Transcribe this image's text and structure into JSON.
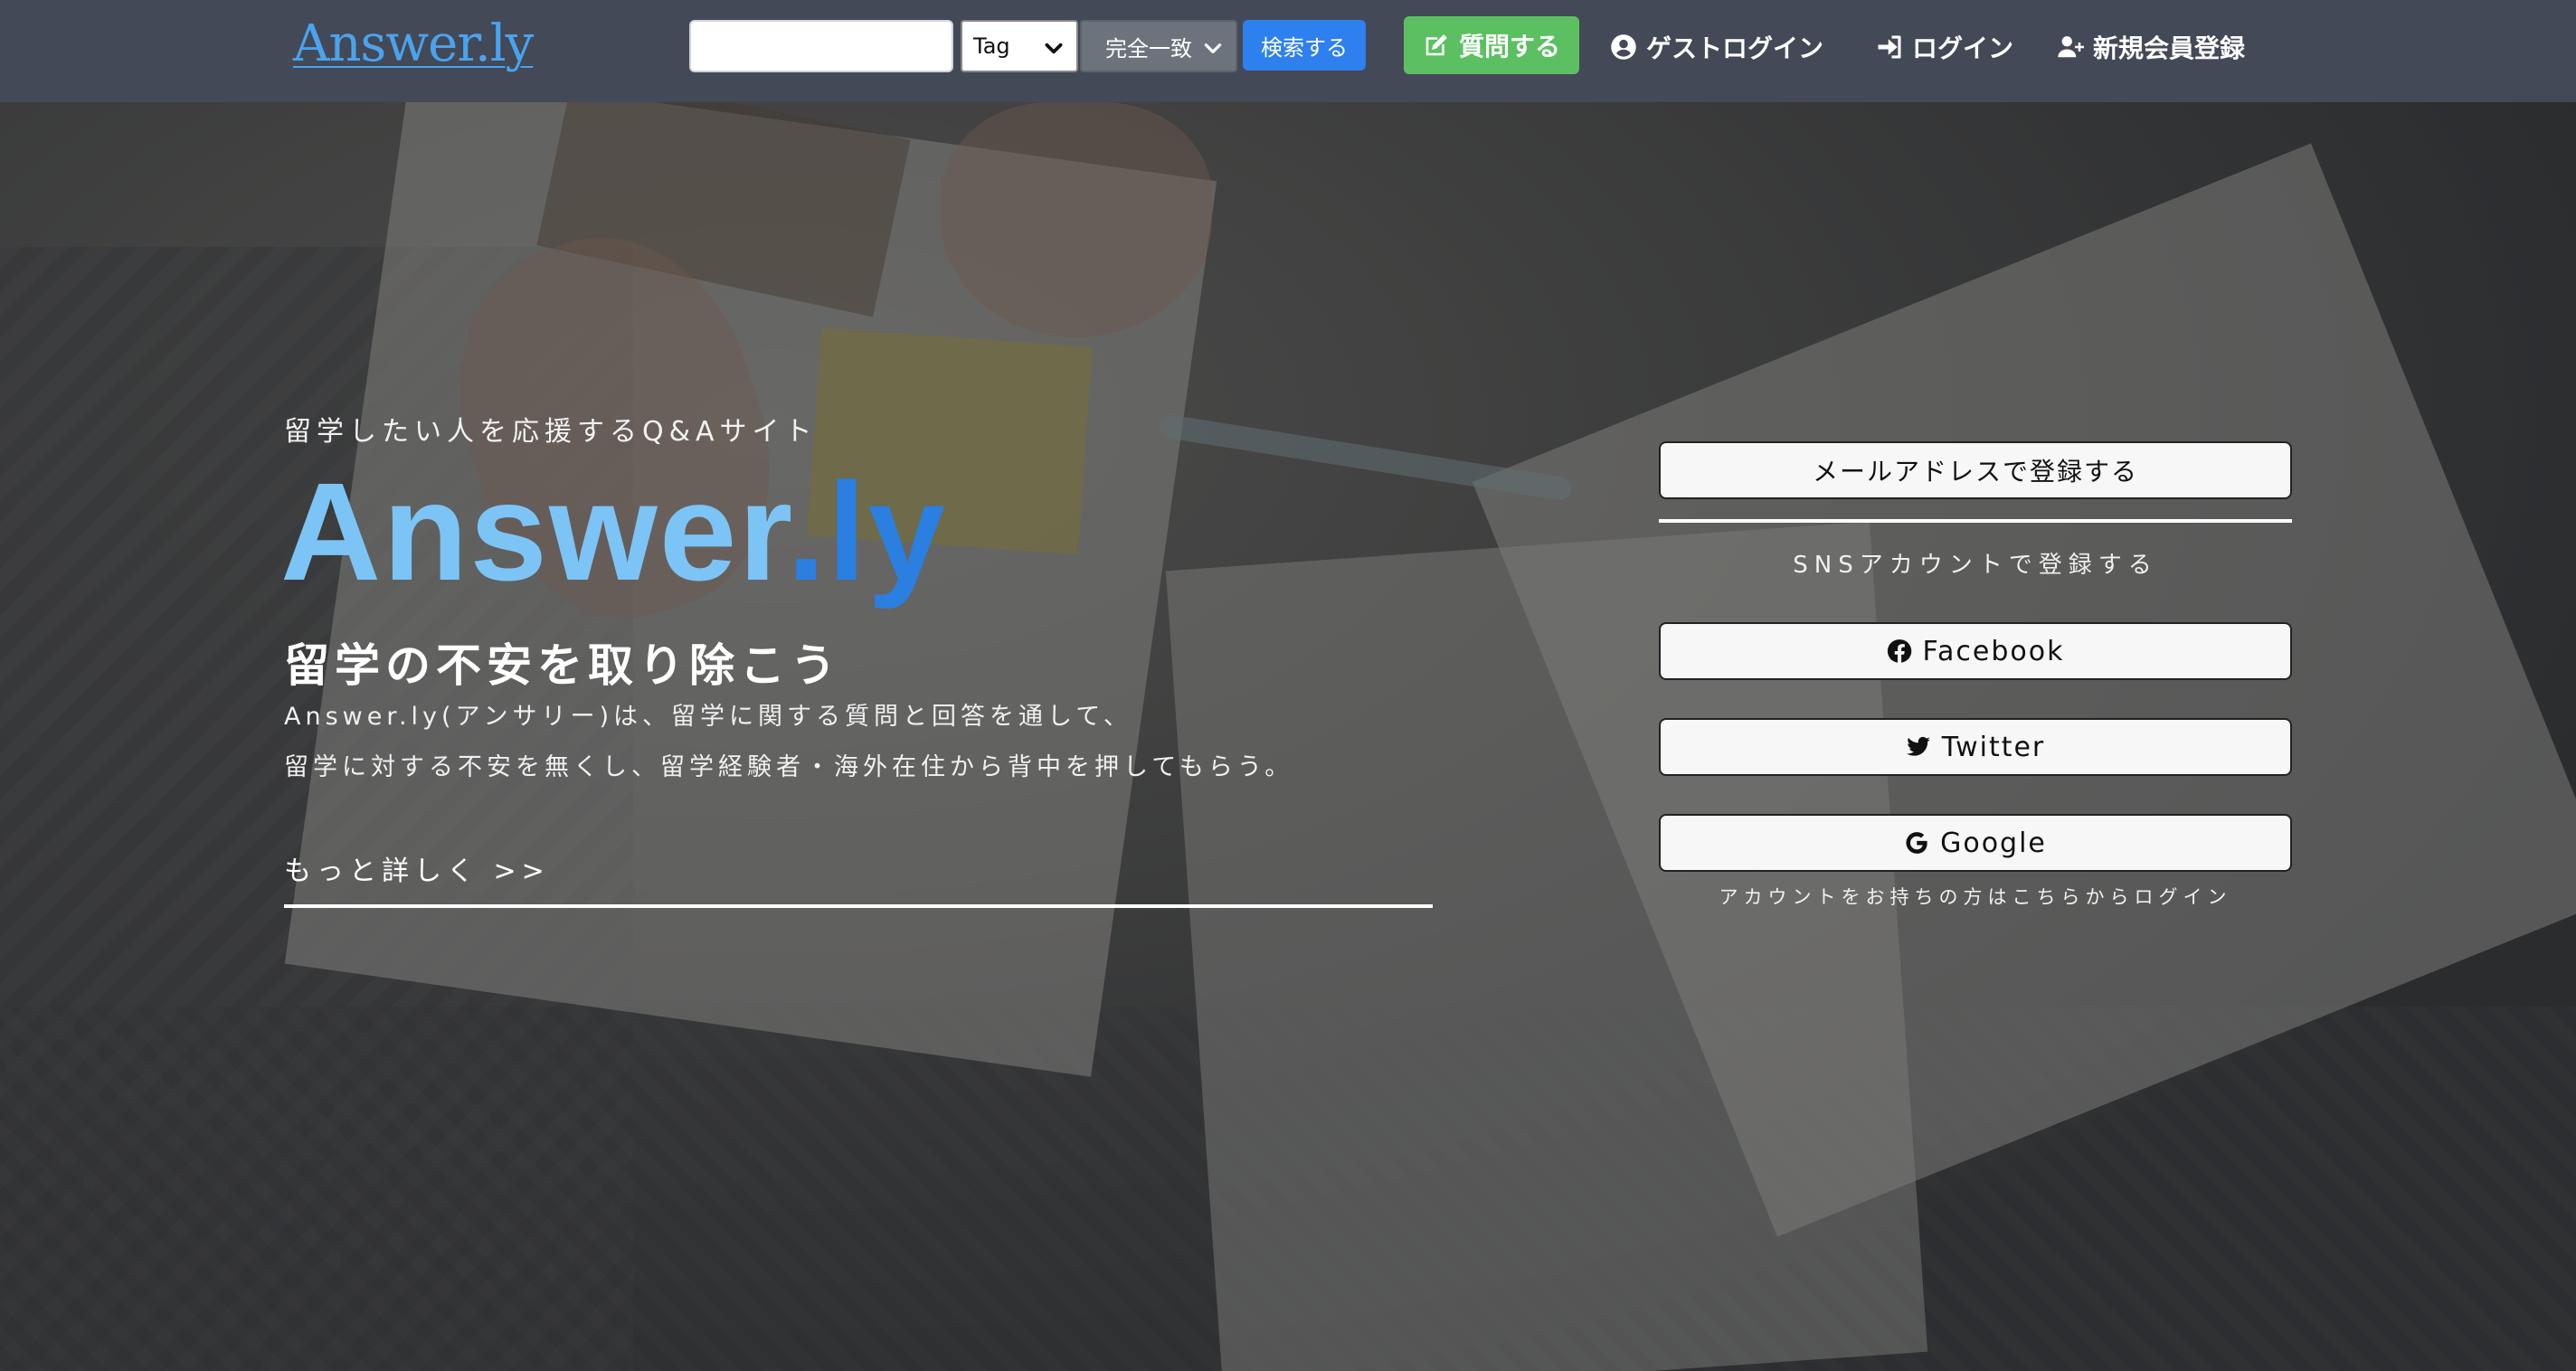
{
  "navbar": {
    "logo": "Answer.ly",
    "search_placeholder": "",
    "tag_select": "Tag",
    "match_select": "完全一致",
    "search_button": "検索する",
    "ask_button": "質問する",
    "guest_login": "ゲストログイン",
    "login": "ログイン",
    "register": "新規会員登録"
  },
  "hero": {
    "subtitle": "留学したい人を応援するQ&Aサイト",
    "title_main": "Answer",
    "title_dot": ".",
    "title_accent": "ly",
    "heading": "留学の不安を取り除こう",
    "desc_line1": "Answer.ly(アンサリー)は、留学に関する質問と回答を通して、",
    "desc_line2": "留学に対する不安を無くし、留学経験者・海外在住から背中を押してもらう。",
    "more_link": "もっと詳しく >>"
  },
  "signup": {
    "email_button": "メールアドレスで登録する",
    "sns_label": "SNSアカウントで登録する",
    "facebook_button": "Facebook",
    "twitter_button": "Twitter",
    "google_button": "Google",
    "login_note": "アカウントをお持ちの方はこちらからログイン"
  },
  "colors": {
    "navbar_bg": "#434956",
    "logo": "#4aa3ef",
    "search_button": "#2e80ee",
    "ask_button": "#5cc062",
    "title_light": "#7cc4f5",
    "title_accent": "#2a7fe0"
  },
  "icons": {
    "ask": "edit-icon",
    "guest": "user-circle-icon",
    "login": "sign-in-icon",
    "register": "user-plus-icon",
    "facebook": "facebook-icon",
    "twitter": "twitter-icon",
    "google": "google-icon"
  }
}
